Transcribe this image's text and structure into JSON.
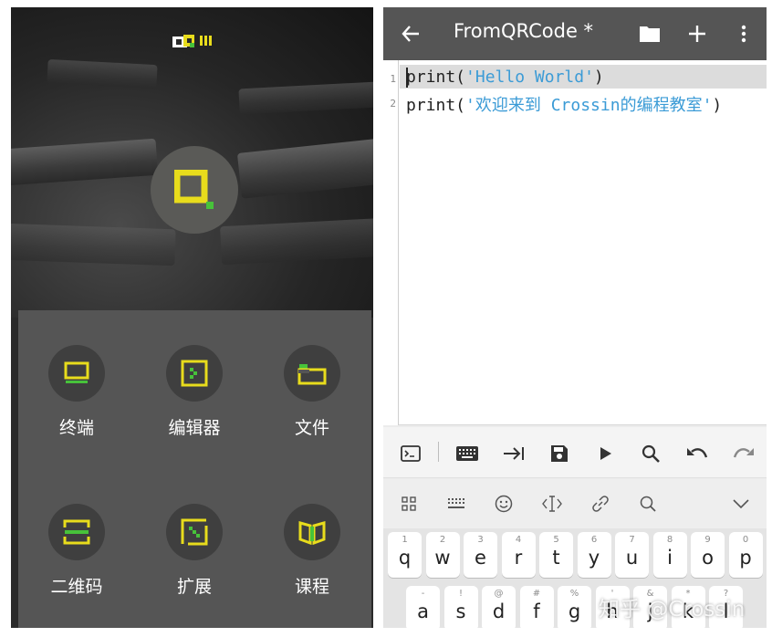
{
  "left_app": {
    "tiles": [
      {
        "label": "终端",
        "icon": "monitor-icon"
      },
      {
        "label": "编辑器",
        "icon": "editor-icon"
      },
      {
        "label": "文件",
        "icon": "folder-icon"
      },
      {
        "label": "二维码",
        "icon": "qr-scan-icon"
      },
      {
        "label": "扩展",
        "icon": "extension-icon"
      },
      {
        "label": "课程",
        "icon": "book-icon"
      }
    ]
  },
  "editor_app": {
    "title": "FromQRCode *",
    "line_numbers": [
      "1",
      "2"
    ],
    "lines": [
      {
        "pre": "print(",
        "str": "'Hello World'",
        "post": ")"
      },
      {
        "pre": "print(",
        "str": "'欢迎来到 Crossin的编程教室'",
        "post": ")"
      }
    ],
    "toolbar_icons": [
      "terminal-icon",
      "keyboard-icon",
      "tab-icon",
      "save-icon",
      "run-icon",
      "search-icon",
      "undo-icon",
      "redo-icon"
    ]
  },
  "keyboard": {
    "row1": [
      {
        "sub": "1",
        "main": "q"
      },
      {
        "sub": "2",
        "main": "w"
      },
      {
        "sub": "3",
        "main": "e"
      },
      {
        "sub": "4",
        "main": "r"
      },
      {
        "sub": "5",
        "main": "t"
      },
      {
        "sub": "6",
        "main": "y"
      },
      {
        "sub": "7",
        "main": "u"
      },
      {
        "sub": "8",
        "main": "i"
      },
      {
        "sub": "9",
        "main": "o"
      },
      {
        "sub": "0",
        "main": "p"
      }
    ],
    "row2": [
      {
        "sub": "-",
        "main": "a"
      },
      {
        "sub": "!",
        "main": "s"
      },
      {
        "sub": "@",
        "main": "d"
      },
      {
        "sub": "#",
        "main": "f"
      },
      {
        "sub": "%",
        "main": "g"
      },
      {
        "sub": "'",
        "main": "h"
      },
      {
        "sub": "&",
        "main": "j"
      },
      {
        "sub": "*",
        "main": "k"
      },
      {
        "sub": "?",
        "main": "l"
      }
    ]
  },
  "watermark": "知乎 @Crossin",
  "colors": {
    "accent_yellow": "#e8dc1c",
    "accent_green": "#47c23a",
    "string_blue": "#3b9bd6",
    "appbar": "#555555"
  }
}
